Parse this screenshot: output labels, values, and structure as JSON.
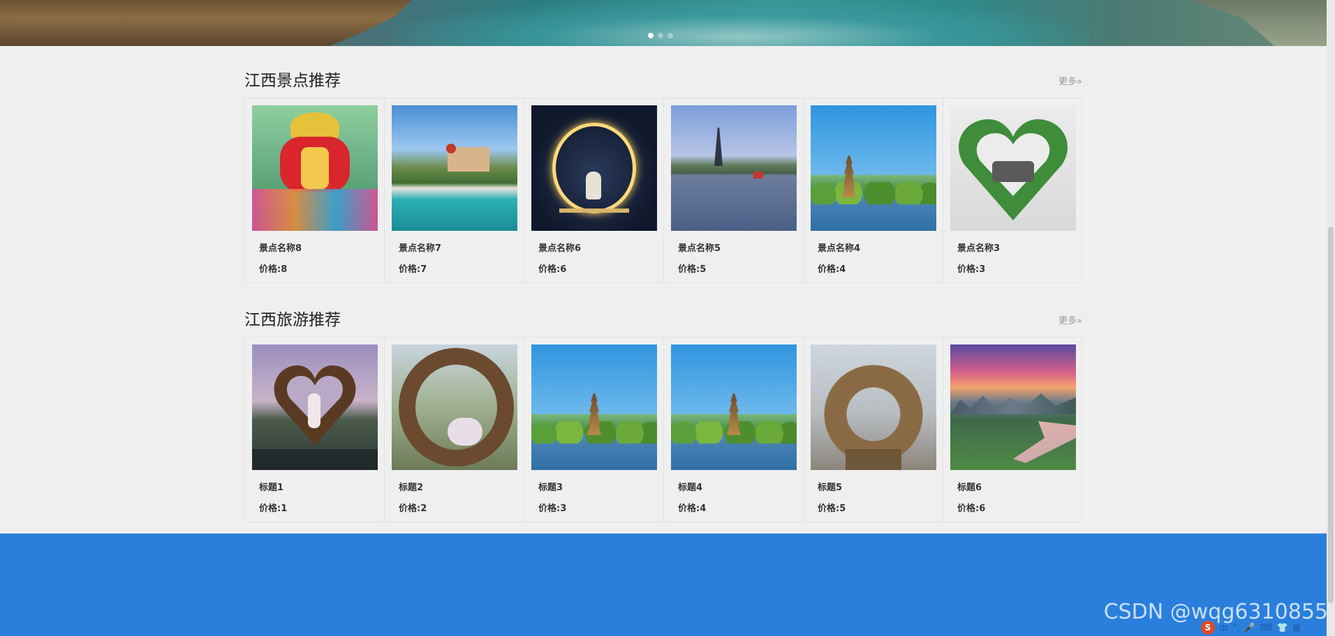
{
  "banner": {
    "slides": 3,
    "active_slide": 0,
    "image_desc": "coastal-rocks-and-sea"
  },
  "section_scenic": {
    "title": "江西景点推荐",
    "more_label": "更多»",
    "items": [
      {
        "name": "景点名称8",
        "price_label": "价格:8",
        "image": "lantern-festival"
      },
      {
        "name": "景点名称7",
        "price_label": "价格:7",
        "image": "lakeside-hill-buildings"
      },
      {
        "name": "景点名称6",
        "price_label": "价格:6",
        "image": "glowing-ring-night"
      },
      {
        "name": "景点名称5",
        "price_label": "价格:5",
        "image": "lake-pagoda-dusk"
      },
      {
        "name": "景点名称4",
        "price_label": "价格:4",
        "image": "lake-pagoda-blue-sky"
      },
      {
        "name": "景点名称3",
        "price_label": "价格:3",
        "image": "green-heart-arch"
      }
    ]
  },
  "section_travel": {
    "title": "江西旅游推荐",
    "more_label": "更多»",
    "items": [
      {
        "name": "标题1",
        "price_label": "价格:1",
        "image": "heart-twig-arch"
      },
      {
        "name": "标题2",
        "price_label": "价格:2",
        "image": "twig-nest-ring"
      },
      {
        "name": "标题3",
        "price_label": "价格:3",
        "image": "lake-pagoda-blue-sky"
      },
      {
        "name": "标题4",
        "price_label": "价格:4",
        "image": "lake-pagoda-blue-sky"
      },
      {
        "name": "标题5",
        "price_label": "价格:5",
        "image": "straw-nest-ring"
      },
      {
        "name": "标题6",
        "price_label": "价格:6",
        "image": "karst-river-sunset"
      }
    ]
  },
  "footer": {
    "color": "#2a7fdc"
  },
  "watermark": "CSDN @wqg6310855",
  "ime": {
    "logo": "S",
    "lang": "中"
  }
}
